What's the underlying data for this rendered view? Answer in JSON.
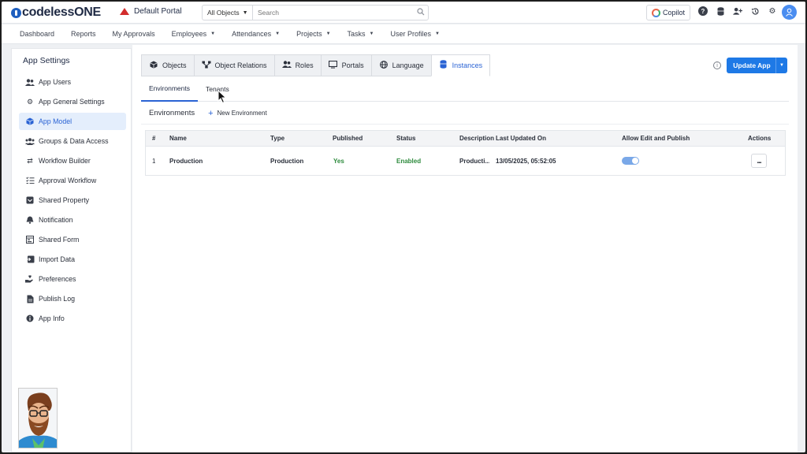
{
  "header": {
    "logo_text": "codelessONE",
    "portal_name": "Default Portal",
    "search_scope": "All Objects",
    "search_placeholder": "Search",
    "copilot_label": "Copilot"
  },
  "nav": {
    "items": [
      {
        "label": "Dashboard",
        "dropdown": false
      },
      {
        "label": "Reports",
        "dropdown": false
      },
      {
        "label": "My Approvals",
        "dropdown": false
      },
      {
        "label": "Employees",
        "dropdown": true
      },
      {
        "label": "Attendances",
        "dropdown": true
      },
      {
        "label": "Projects",
        "dropdown": true
      },
      {
        "label": "Tasks",
        "dropdown": true
      },
      {
        "label": "User Profiles",
        "dropdown": true
      }
    ]
  },
  "sidebar": {
    "title": "App Settings",
    "items": [
      {
        "label": "App Users",
        "icon": "users-icon"
      },
      {
        "label": "App General Settings",
        "icon": "gear-icon"
      },
      {
        "label": "App Model",
        "icon": "cube-icon",
        "active": true
      },
      {
        "label": "Groups & Data Access",
        "icon": "group-icon"
      },
      {
        "label": "Workflow Builder",
        "icon": "swap-arrows-icon"
      },
      {
        "label": "Approval Workflow",
        "icon": "checklist-icon"
      },
      {
        "label": "Shared Property",
        "icon": "shared-property-icon"
      },
      {
        "label": "Notification",
        "icon": "bell-icon"
      },
      {
        "label": "Shared Form",
        "icon": "form-icon"
      },
      {
        "label": "Import Data",
        "icon": "import-icon"
      },
      {
        "label": "Preferences",
        "icon": "hand-heart-icon"
      },
      {
        "label": "Publish Log",
        "icon": "document-icon"
      },
      {
        "label": "App Info",
        "icon": "info-icon"
      }
    ]
  },
  "tabs": {
    "items": [
      {
        "label": "Objects",
        "icon": "cube-icon"
      },
      {
        "label": "Object Relations",
        "icon": "relations-icon"
      },
      {
        "label": "Roles",
        "icon": "users-icon"
      },
      {
        "label": "Portals",
        "icon": "monitor-icon"
      },
      {
        "label": "Language",
        "icon": "globe-icon"
      },
      {
        "label": "Instances",
        "icon": "database-icon",
        "active": true
      }
    ],
    "update_button": "Update App"
  },
  "subtabs": {
    "items": [
      {
        "label": "Environments",
        "active": true
      },
      {
        "label": "Tenants",
        "active": false
      }
    ]
  },
  "toolbar": {
    "section_label": "Environments",
    "new_button": "New Environment"
  },
  "table": {
    "headers": [
      "#",
      "Name",
      "Type",
      "Published",
      "Status",
      "Description",
      "Last Updated On",
      "Allow Edit and Publish",
      "Actions"
    ],
    "rows": [
      {
        "index": "1",
        "name": "Production",
        "type": "Production",
        "published": "Yes",
        "status": "Enabled",
        "description": "Producti...",
        "last_updated": "13/05/2025, 05:52:05",
        "allow_edit": true,
        "actions": "..."
      }
    ]
  },
  "colors": {
    "accent": "#2a63d4",
    "primary_button": "#1e79e6",
    "status_green": "#2c8a3c"
  }
}
